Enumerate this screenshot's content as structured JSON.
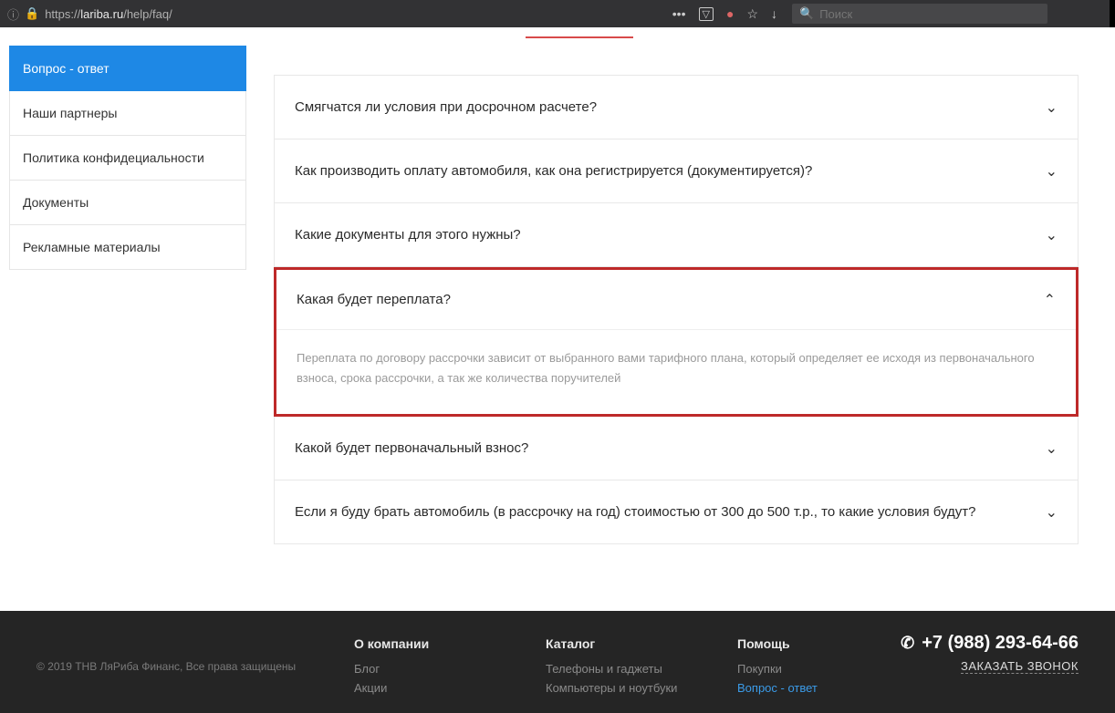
{
  "browser": {
    "url_prefix": "https://",
    "url_domain": "lariba.ru",
    "url_path": "/help/faq/",
    "search_placeholder": "Поиск"
  },
  "sidebar": {
    "items": [
      {
        "label": "Вопрос - ответ",
        "active": true
      },
      {
        "label": "Наши партнеры",
        "active": false
      },
      {
        "label": "Политика конфидециальности",
        "active": false
      },
      {
        "label": "Документы",
        "active": false
      },
      {
        "label": "Рекламные материалы",
        "active": false
      }
    ]
  },
  "faq": {
    "items": [
      {
        "q": "Смягчатся ли условия при досрочном расчете?",
        "expanded": false
      },
      {
        "q": "Как производить оплату автомобиля, как она регистрируется (документируется)?",
        "expanded": false
      },
      {
        "q": "Какие документы для этого нужны?",
        "expanded": false
      },
      {
        "q": "Какая будет переплата?",
        "expanded": true,
        "a": "Переплата по договору рассрочки зависит от выбранного вами тарифного плана, который определяет ее исходя из первоначального взноса, срока рассрочки, а так же количества поручителей"
      },
      {
        "q": "Какой будет первоначальный взнос?",
        "expanded": false
      },
      {
        "q": "Если я буду брать автомобиль (в рассрочку на год) стоимостью от 300 до 500 т.р., то какие условия будут?",
        "expanded": false
      }
    ]
  },
  "footer": {
    "copyright": "© 2019 ТНВ ЛяРиба Финанс, Все права защищены",
    "cols": [
      {
        "title": "О компании",
        "links": [
          "Блог",
          "Акции"
        ]
      },
      {
        "title": "Каталог",
        "links": [
          "Телефоны и гаджеты",
          "Компьютеры и ноутбуки"
        ]
      },
      {
        "title": "Помощь",
        "links": [
          "Покупки",
          "Вопрос - ответ"
        ],
        "active_index": 1
      }
    ],
    "phone": "+7 (988) 293-64-66",
    "callback": "ЗАКАЗАТЬ ЗВОНОК"
  }
}
